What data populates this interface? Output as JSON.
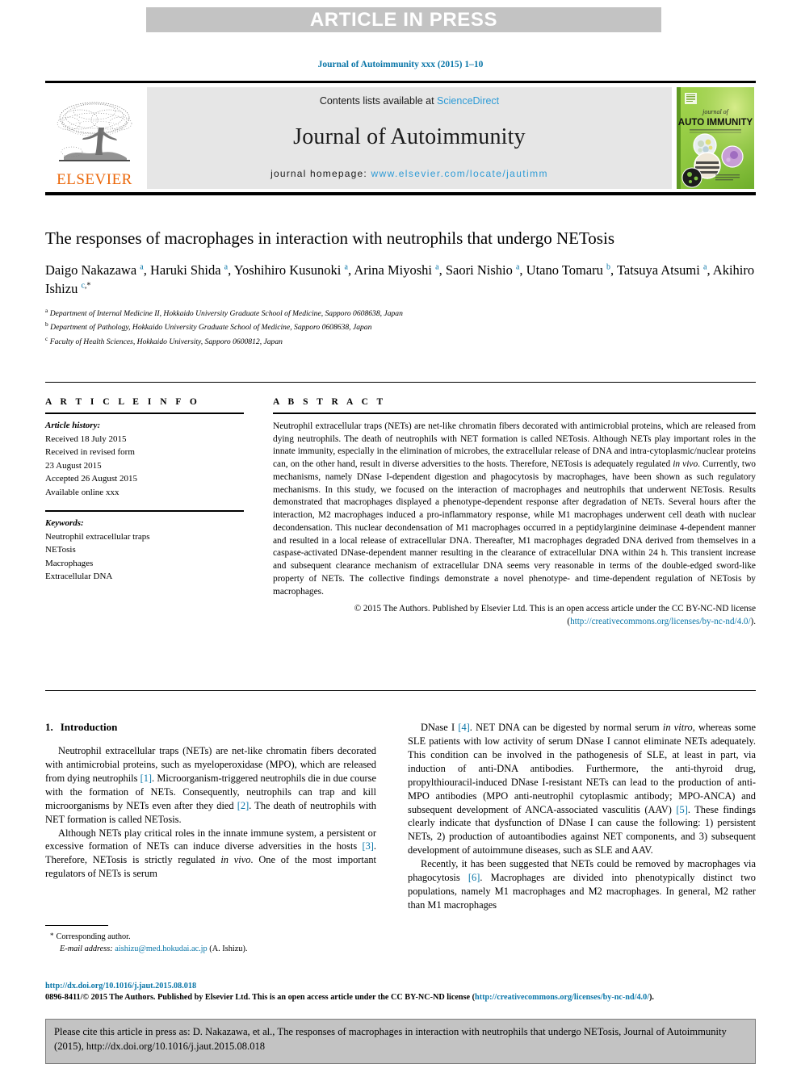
{
  "banner": {
    "label": "ARTICLE IN PRESS"
  },
  "running_head": "Journal of Autoimmunity xxx (2015) 1–10",
  "masthead": {
    "contents_prefix": "Contents lists available at ",
    "sciencedirect": "ScienceDirect",
    "journal_title": "Journal of Autoimmunity",
    "homepage_prefix": "journal homepage: ",
    "homepage_url": "www.elsevier.com/locate/jautimm",
    "publisher": "ELSEVIER",
    "cover": {
      "line1": "journal of",
      "line2": "AUTO IMMUNITY"
    }
  },
  "colors": {
    "link": "#0a76a8",
    "link_light": "#2e9bd6",
    "elsevier_orange": "#eb6608",
    "banner_gray": "#c3c3c3",
    "masthead_gray": "#e6e6e6",
    "cover_green": "#8cc63e"
  },
  "article": {
    "title": "The responses of macrophages in interaction with neutrophils that undergo NETosis",
    "authors": [
      {
        "name": "Daigo Nakazawa",
        "marks": [
          "a"
        ]
      },
      {
        "name": "Haruki Shida",
        "marks": [
          "a"
        ]
      },
      {
        "name": "Yoshihiro Kusunoki",
        "marks": [
          "a"
        ]
      },
      {
        "name": "Arina Miyoshi",
        "marks": [
          "a"
        ]
      },
      {
        "name": "Saori Nishio",
        "marks": [
          "a"
        ]
      },
      {
        "name": "Utano Tomaru",
        "marks": [
          "b"
        ]
      },
      {
        "name": "Tatsuya Atsumi",
        "marks": [
          "a"
        ]
      },
      {
        "name": "Akihiro Ishizu",
        "marks": [
          "c",
          "*"
        ]
      }
    ],
    "affiliations": [
      {
        "mark": "a",
        "text": "Department of Internal Medicine II, Hokkaido University Graduate School of Medicine, Sapporo 0608638, Japan"
      },
      {
        "mark": "b",
        "text": "Department of Pathology, Hokkaido University Graduate School of Medicine, Sapporo 0608638, Japan"
      },
      {
        "mark": "c",
        "text": "Faculty of Health Sciences, Hokkaido University, Sapporo 0600812, Japan"
      }
    ]
  },
  "article_info": {
    "heading": "A R T I C L E  I N F O",
    "history_label": "Article history:",
    "history": [
      "Received 18 July 2015",
      "Received in revised form",
      "23 August 2015",
      "Accepted 26 August 2015",
      "Available online xxx"
    ],
    "keywords_label": "Keywords:",
    "keywords": [
      "Neutrophil extracellular traps",
      "NETosis",
      "Macrophages",
      "Extracellular DNA"
    ]
  },
  "abstract": {
    "heading": "A B S T R A C T",
    "part1": "Neutrophil extracellular traps (NETs) are net-like chromatin fibers decorated with antimicrobial proteins, which are released from dying neutrophils. The death of neutrophils with NET formation is called NETosis. Although NETs play important roles in the innate immunity, especially in the elimination of microbes, the extracellular release of DNA and intra-cytoplasmic/nuclear proteins can, on the other hand, result in diverse adversities to the hosts. Therefore, NETosis is adequately regulated ",
    "italic1": "in vivo",
    "part2": ". Currently, two mechanisms, namely DNase I-dependent digestion and phagocytosis by macrophages, have been shown as such regulatory mechanisms. In this study, we focused on the interaction of macrophages and neutrophils that underwent NETosis. Results demonstrated that macrophages displayed a phenotype-dependent response after degradation of NETs. Several hours after the interaction, M2 macrophages induced a pro-inflammatory response, while M1 macrophages underwent cell death with nuclear decondensation. This nuclear decondensation of M1 macrophages occurred in a peptidylarginine deiminase 4-dependent manner and resulted in a local release of extracellular DNA. Thereafter, M1 macrophages degraded DNA derived from themselves in a caspase-activated DNase-dependent manner resulting in the clearance of extracellular DNA within 24 h. This transient increase and subsequent clearance mechanism of extracellular DNA seems very reasonable in terms of the double-edged sword-like property of NETs. The collective findings demonstrate a novel phenotype- and time-dependent regulation of NETosis by macrophages.",
    "copyright_prefix": "© 2015 The Authors. Published by Elsevier Ltd. This is an open access article under the CC BY-NC-ND license (",
    "copyright_link": "http://creativecommons.org/licenses/by-nc-nd/4.0/",
    "copyright_suffix": ")."
  },
  "introduction": {
    "section_number": "1.",
    "section_title": "Introduction",
    "left_paragraphs": [
      {
        "runs": [
          {
            "t": "Neutrophil extracellular traps (NETs) are net-like chromatin fibers decorated with antimicrobial proteins, such as myeloperoxidase (MPO), which are released from dying neutrophils "
          },
          {
            "t": "[1]",
            "k": "ref"
          },
          {
            "t": ". Microorganism-triggered neutrophils die in due course with the formation of NETs. Consequently, neutrophils can trap and kill microorganisms by NETs even after they died "
          },
          {
            "t": "[2]",
            "k": "ref"
          },
          {
            "t": ". The death of neutrophils with NET formation is called NETosis."
          }
        ]
      },
      {
        "runs": [
          {
            "t": "Although NETs play critical roles in the innate immune system, a persistent or excessive formation of NETs can induce diverse adversities in the hosts "
          },
          {
            "t": "[3]",
            "k": "ref"
          },
          {
            "t": ". Therefore, NETosis is strictly regulated "
          },
          {
            "t": "in vivo",
            "k": "i"
          },
          {
            "t": ". One of the most important regulators of NETs is serum"
          }
        ]
      }
    ],
    "right_paragraphs": [
      {
        "runs": [
          {
            "t": "DNase I "
          },
          {
            "t": "[4]",
            "k": "ref"
          },
          {
            "t": ". NET DNA can be digested by normal serum "
          },
          {
            "t": "in vitro",
            "k": "i"
          },
          {
            "t": ", whereas some SLE patients with low activity of serum DNase I cannot eliminate NETs adequately. This condition can be involved in the pathogenesis of SLE, at least in part, via induction of anti-DNA antibodies. Furthermore, the anti-thyroid drug, propylthiouracil-induced DNase I-resistant NETs can lead to the production of anti-MPO antibodies (MPO anti-neutrophil cytoplasmic antibody; MPO-ANCA) and subsequent development of ANCA-associated vasculitis (AAV) "
          },
          {
            "t": "[5]",
            "k": "ref"
          },
          {
            "t": ". These findings clearly indicate that dysfunction of DNase I can cause the following: 1) persistent NETs, 2) production of autoantibodies against NET components, and 3) subsequent development of autoimmune diseases, such as SLE and AAV."
          }
        ]
      },
      {
        "runs": [
          {
            "t": "Recently, it has been suggested that NETs could be removed by macrophages via phagocytosis "
          },
          {
            "t": "[6]",
            "k": "ref"
          },
          {
            "t": ". Macrophages are divided into phenotypically distinct two populations, namely M1 macrophages and M2 macrophages. In general, M2 rather than M1 macrophages"
          }
        ]
      }
    ]
  },
  "corresponding": {
    "star": "*",
    "label": "Corresponding author.",
    "email_label": "E-mail address:",
    "email": "aishizu@med.hokudai.ac.jp",
    "email_person": "(A. Ishizu)."
  },
  "legal": {
    "doi": "http://dx.doi.org/10.1016/j.jaut.2015.08.018",
    "issn_prefix": "0896-8411/© 2015 The Authors. Published by Elsevier Ltd. This is an open access article under the CC BY-NC-ND license (",
    "issn_link": "http://creativecommons.org/licenses/by-nc-nd/4.0/",
    "issn_suffix": ")."
  },
  "cite_box": {
    "text": "Please cite this article in press as: D. Nakazawa, et al., The responses of macrophages in interaction with neutrophils that undergo NETosis, Journal of Autoimmunity (2015), http://dx.doi.org/10.1016/j.jaut.2015.08.018"
  }
}
